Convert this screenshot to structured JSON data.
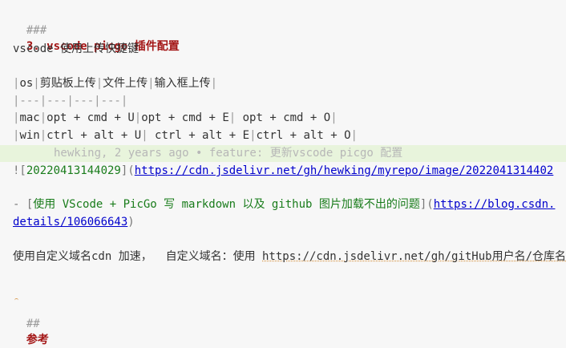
{
  "heading1": {
    "hashes": "###",
    "text": "3. vscode picgo 插件配置"
  },
  "intro": "vscode 使用上传快捷键",
  "table": {
    "header": [
      "os",
      "剪贴板上传",
      "文件上传",
      "输入框上传"
    ],
    "divider": "|---|---|---|---|",
    "rows": [
      [
        "mac",
        "opt + cmd + U",
        "opt + cmd + E",
        " opt + cmd + O"
      ],
      [
        "win",
        "ctrl + alt + U",
        " ctrl + alt + E",
        "ctrl + alt + O"
      ]
    ]
  },
  "blame": "hewking, 2 years ago • feature: 更新vscode picgo 配置",
  "image_line": {
    "prefix": "![",
    "alt": "20220413144029",
    "mid": "](",
    "url": "https://cdn.jsdelivr.net/gh/hewking/myrepo/image/2022041314402"
  },
  "link_item": {
    "bullet": "- [",
    "text": "使用 VScode + PicGo 写 markdown 以及 github 图片加载不出的问题",
    "mid": "](",
    "url_part1": "https://blog.csdn.",
    "url_part2": "details/106066643",
    "close": ")"
  },
  "cdn_note": {
    "text": "使用自定义域名cdn 加速，  自定义域名：使用 ",
    "url": "https://cdn.jsdelivr.net/gh/gitHub用户名/仓库名"
  },
  "heading2": {
    "hashes": "##",
    "text": "参考"
  },
  "colors": {
    "heading": "#a31515",
    "link": "#0000cc",
    "link_text": "#197c1b",
    "blame_bg": "#e8f4dc"
  }
}
